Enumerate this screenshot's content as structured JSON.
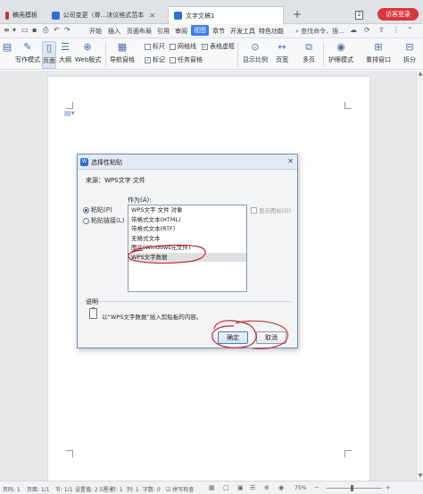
{
  "titlebar": {
    "tabs": [
      {
        "label": "稿壳模板",
        "icon_color": "#c0392b"
      },
      {
        "label": "公司变更（脊...决议格式范本",
        "icon_color": "#2f6fd6"
      },
      {
        "label": "文字文稿1",
        "icon_color": "#2f6fd6"
      }
    ],
    "new_tab": "+",
    "page_count": "2",
    "visitor_label": "访客登录"
  },
  "menubar": {
    "items": [
      "开始",
      "插入",
      "页面布局",
      "引用",
      "审阅",
      "视图",
      "章节",
      "开发工具",
      "特色功能"
    ],
    "active": "视图",
    "search": "查找命令、搜..."
  },
  "ribbon": {
    "buttons": [
      {
        "label": "写作模式",
        "icon": "pen-icon"
      },
      {
        "label": "页面",
        "icon": "page-icon"
      },
      {
        "label": "大纲",
        "icon": "outline-icon"
      },
      {
        "label": "Web版式",
        "icon": "web-icon"
      },
      {
        "label": "导航窗格",
        "icon": "nav-pane-icon"
      },
      {
        "label": "显示比例",
        "icon": "zoom-icon"
      },
      {
        "label": "页宽",
        "icon": "page-width-icon"
      },
      {
        "label": "多页",
        "icon": "multi-page-icon"
      },
      {
        "label": "护眼模式",
        "icon": "eye-icon"
      },
      {
        "label": "重排窗口",
        "icon": "rearrange-icon"
      },
      {
        "label": "拆分",
        "icon": "split-icon"
      }
    ],
    "checks": [
      {
        "label": "标尺",
        "checked": false
      },
      {
        "label": "网格线",
        "checked": false
      },
      {
        "label": "表格虚框",
        "checked": true
      },
      {
        "label": "标记",
        "checked": true
      },
      {
        "label": "任务窗格",
        "checked": false
      }
    ]
  },
  "dialog": {
    "title": "选择性粘贴",
    "source_label": "来源：WPS文字 文件",
    "as_label": "作为(A):",
    "radios": [
      {
        "label": "粘贴(P)",
        "checked": true
      },
      {
        "label": "粘贴链接(L)",
        "checked": false
      }
    ],
    "list_items": [
      "WPS文字 文件 对象",
      "带格式文本(HTML)",
      "带格式文本(RTF)",
      "无格式文本",
      "图片(Windows元文件)",
      "WPS文字数据"
    ],
    "selected_index": 5,
    "show_as_icon": "显示图标(D)",
    "description_label": "说明",
    "description_text": "以“WPS文字数据”插入剪贴板的内容。",
    "ok_label": "确定",
    "cancel_label": "取消",
    "annotation_color": "#c0262d"
  },
  "statusbar": {
    "page": "页码: 1",
    "pages": "页面: 1/1",
    "section": "节: 1/1",
    "setting": "设置值: 2.5厘米",
    "row": "行: 1",
    "col": "列: 1",
    "words": "字数: 0",
    "spell": "拼写检查",
    "zoom": "75%"
  }
}
